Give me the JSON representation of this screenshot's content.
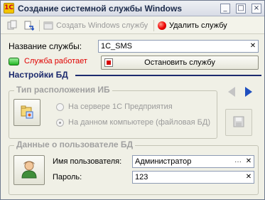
{
  "window": {
    "title": "Создание системной службы Windows",
    "logo_text": "1C",
    "controls": {
      "minimize": "_",
      "maximize": "□",
      "close": "×"
    }
  },
  "toolbar": {
    "create_service_label": "Создать Windows службу",
    "delete_service_label": "Удалить службу"
  },
  "service": {
    "name_label": "Название службы:",
    "name_value": "1C_SMS",
    "status_text": "Служба работает",
    "stop_button_label": "Остановить службу"
  },
  "db_settings": {
    "section_title": "Настройки БД",
    "location_group_title": "Тип расположения ИБ",
    "options": [
      {
        "label": "На сервере 1С Предприятия",
        "selected": false
      },
      {
        "label": "На данном компьютере (файловая БД)",
        "selected": true
      }
    ]
  },
  "user": {
    "group_title": "Данные о пользователе БД",
    "username_label": "Имя пользователя:",
    "username_value": "Администратор",
    "password_label": "Пароль:",
    "password_value": "123"
  },
  "colors": {
    "accent": "#1d2b6e",
    "status": "#e00000",
    "nav_arrow": "#1f4fbf"
  }
}
